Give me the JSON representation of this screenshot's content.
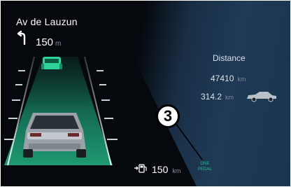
{
  "navigation": {
    "street": "Av de Lauzun",
    "distance_value": "150",
    "distance_unit": "m",
    "turn_icon": "turn-left-icon"
  },
  "trip": {
    "distance_label": "Distance",
    "odometer_value": "47410",
    "odometer_unit": "km",
    "trip_value": "314.2",
    "trip_unit": "km"
  },
  "range": {
    "icon": "fuel-range-icon",
    "value": "150",
    "unit": "km"
  },
  "mode": {
    "line1": "ONE",
    "line2": "PEDAL",
    "color": "#25c08b"
  },
  "callout": {
    "number": "3"
  },
  "colors": {
    "lane_active": "#1f9a72",
    "lead_vehicle": "#2fd39a",
    "background": "#05080d",
    "panel": "#1b3550"
  }
}
